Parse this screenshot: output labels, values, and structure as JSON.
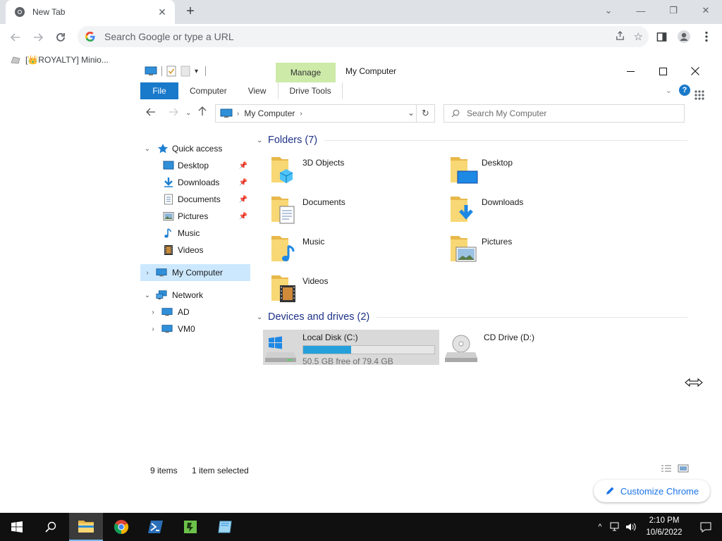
{
  "browser": {
    "tab_title": "New Tab",
    "omnibox_placeholder": "Search Google or type a URL",
    "bookmark_label": "[👑ROYALTY] Minio...",
    "customize_label": "Customize Chrome"
  },
  "explorer": {
    "manage_label": "Manage",
    "window_title": "My Computer",
    "ribbon_tabs": [
      "File",
      "Computer",
      "View",
      "Drive Tools"
    ],
    "address_crumb": "My Computer",
    "search_placeholder": "Search My Computer",
    "nav": {
      "quick_access": "Quick access",
      "quick_items": [
        "Desktop",
        "Downloads",
        "Documents",
        "Pictures",
        "Music",
        "Videos"
      ],
      "my_computer": "My Computer",
      "network": "Network",
      "network_items": [
        "AD",
        "VM0"
      ]
    },
    "folders_header": "Folders (7)",
    "folders": [
      "3D Objects",
      "Desktop",
      "Documents",
      "Downloads",
      "Music",
      "Pictures",
      "Videos"
    ],
    "drives_header": "Devices and drives (2)",
    "drives": [
      {
        "name": "Local Disk (C:)",
        "free_text": "50.5 GB free of 79.4 GB",
        "used_fraction": 0.364
      },
      {
        "name": "CD Drive (D:)"
      }
    ],
    "status": {
      "items": "9 items",
      "selected": "1 item selected"
    }
  },
  "taskbar": {
    "time": "2:10 PM",
    "date": "10/6/2022"
  },
  "colors": {
    "accent": "#1979ca",
    "manage_tab": "#cdeaa9",
    "selection": "#cce8ff",
    "folder_yellow": "#f8d775",
    "progress": "#26a0da"
  }
}
